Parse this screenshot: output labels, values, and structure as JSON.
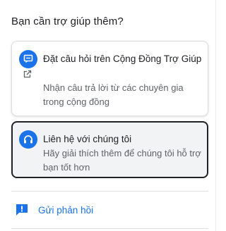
{
  "help_panel": {
    "heading": "Bạn cần trợ giúp thêm?",
    "community_card": {
      "icon": "forum-icon",
      "external_icon": "open-in-new-icon",
      "title": "Đặt câu hỏi trên Cộng Đồng Trợ Giúp",
      "description": "Nhận câu trả lời từ các chuyên gia trong cộng đồng"
    },
    "contact_card": {
      "icon": "headset-icon",
      "title": "Liên hệ với chúng tôi",
      "description": "Hãy giải thích thêm để chúng tôi hỗ trợ bạn tốt hơn"
    },
    "feedback": {
      "icon": "feedback-icon",
      "label": "Gửi phản hồi"
    }
  },
  "colors": {
    "accent": "#1a73e8",
    "text_primary": "#202124",
    "text_secondary": "#5f6368",
    "selected_card_bg": "#f1f3f4"
  }
}
